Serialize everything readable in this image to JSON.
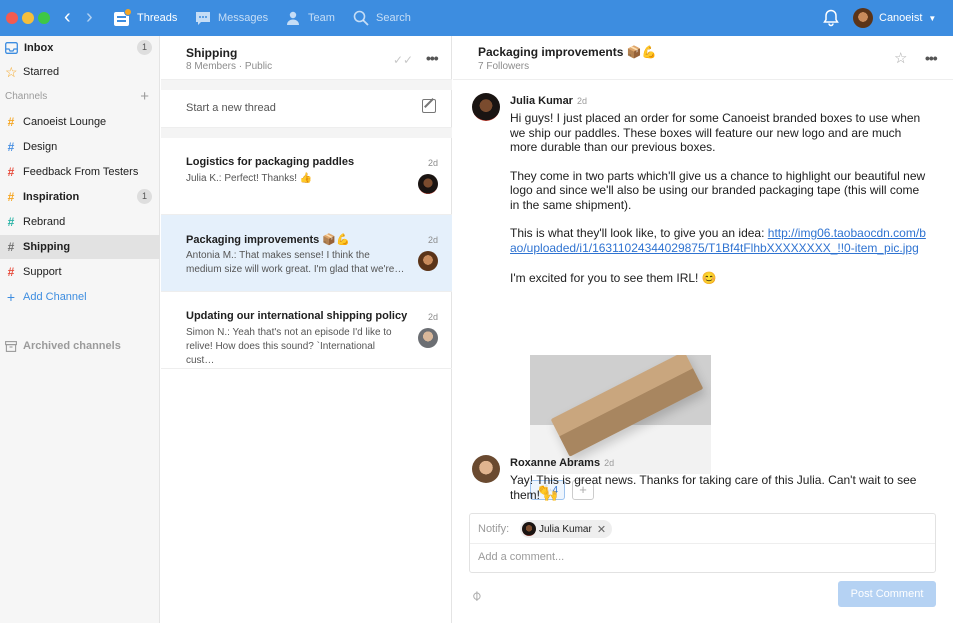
{
  "topbar": {
    "nav": [
      {
        "label": "Threads",
        "icon": "threads-icon"
      },
      {
        "label": "Messages",
        "icon": "messages-icon"
      },
      {
        "label": "Team",
        "icon": "team-icon"
      },
      {
        "label": "Search",
        "icon": "search-icon"
      }
    ],
    "account_name": "Canoeist"
  },
  "sidebar": {
    "inbox": {
      "label": "Inbox",
      "badge": "1"
    },
    "starred": {
      "label": "Starred"
    },
    "channels_header": "Channels",
    "channels": [
      {
        "label": "Canoeist Lounge",
        "color": "#f5a623"
      },
      {
        "label": "Design",
        "color": "#4a90e2"
      },
      {
        "label": "Feedback From Testers",
        "color": "#e74c3c"
      },
      {
        "label": "Inspiration",
        "color": "#f5a623",
        "badge": "1",
        "bold": true
      },
      {
        "label": "Rebrand",
        "color": "#2ab3a6"
      },
      {
        "label": "Shipping",
        "color": "#707070",
        "selected": true
      },
      {
        "label": "Support",
        "color": "#e74c3c"
      }
    ],
    "add_channel": "Add Channel",
    "archived": "Archived channels"
  },
  "threadlist": {
    "title": "Shipping",
    "subtitle": "8 Members · Public",
    "new_thread": "Start a new thread",
    "threads": [
      {
        "title": "Logistics for packaging paddles",
        "time": "2d",
        "snippet": "Julia K.: Perfect! Thanks! 👍"
      },
      {
        "title": "Packaging improvements 📦💪",
        "time": "2d",
        "snippet": "Antonia M.: That makes sense! I think the medium size will work great. I'm glad that we're…"
      },
      {
        "title": "Updating our international shipping policy",
        "time": "2d",
        "snippet": "Simon N.: Yeah that's not an episode I'd like to relive!  How does this sound? `International cust…"
      }
    ]
  },
  "main": {
    "title": "Packaging improvements 📦💪",
    "subtitle": "7 Followers",
    "messages": [
      {
        "author": "Julia Kumar",
        "when": "2d",
        "p1": "Hi guys! I just placed an order for some Canoeist branded boxes to use when we ship our paddles. These boxes will feature our new logo and are much more durable than our previous boxes.",
        "p2": "They come in two parts which'll give us a chance to highlight our beautiful new logo and since we'll also be using our branded packaging tape (this will come in the same shipment).",
        "p3_prefix": "This is what they'll look like, to give you an idea: ",
        "link": "http://img06.taobaocdn.com/bao/uploaded/i1/16311024344029875/T1Bf4tFlhbXXXXXXXX_!!0-item_pic.jpg",
        "p4": "I'm excited for you to see them IRL! 😊",
        "reaction_emoji": "👏",
        "reaction_count": "4",
        "reaction_add": "+"
      },
      {
        "author": "Roxanne Abrams",
        "when": "2d",
        "text": "Yay! This is great news. Thanks for taking care of this Julia. Can't wait to see them! 🙌"
      }
    ],
    "composer": {
      "notify_label": "Notify:",
      "notify_chip": "Julia Kumar",
      "placeholder": "Add a comment...",
      "post_label": "Post Comment"
    }
  }
}
